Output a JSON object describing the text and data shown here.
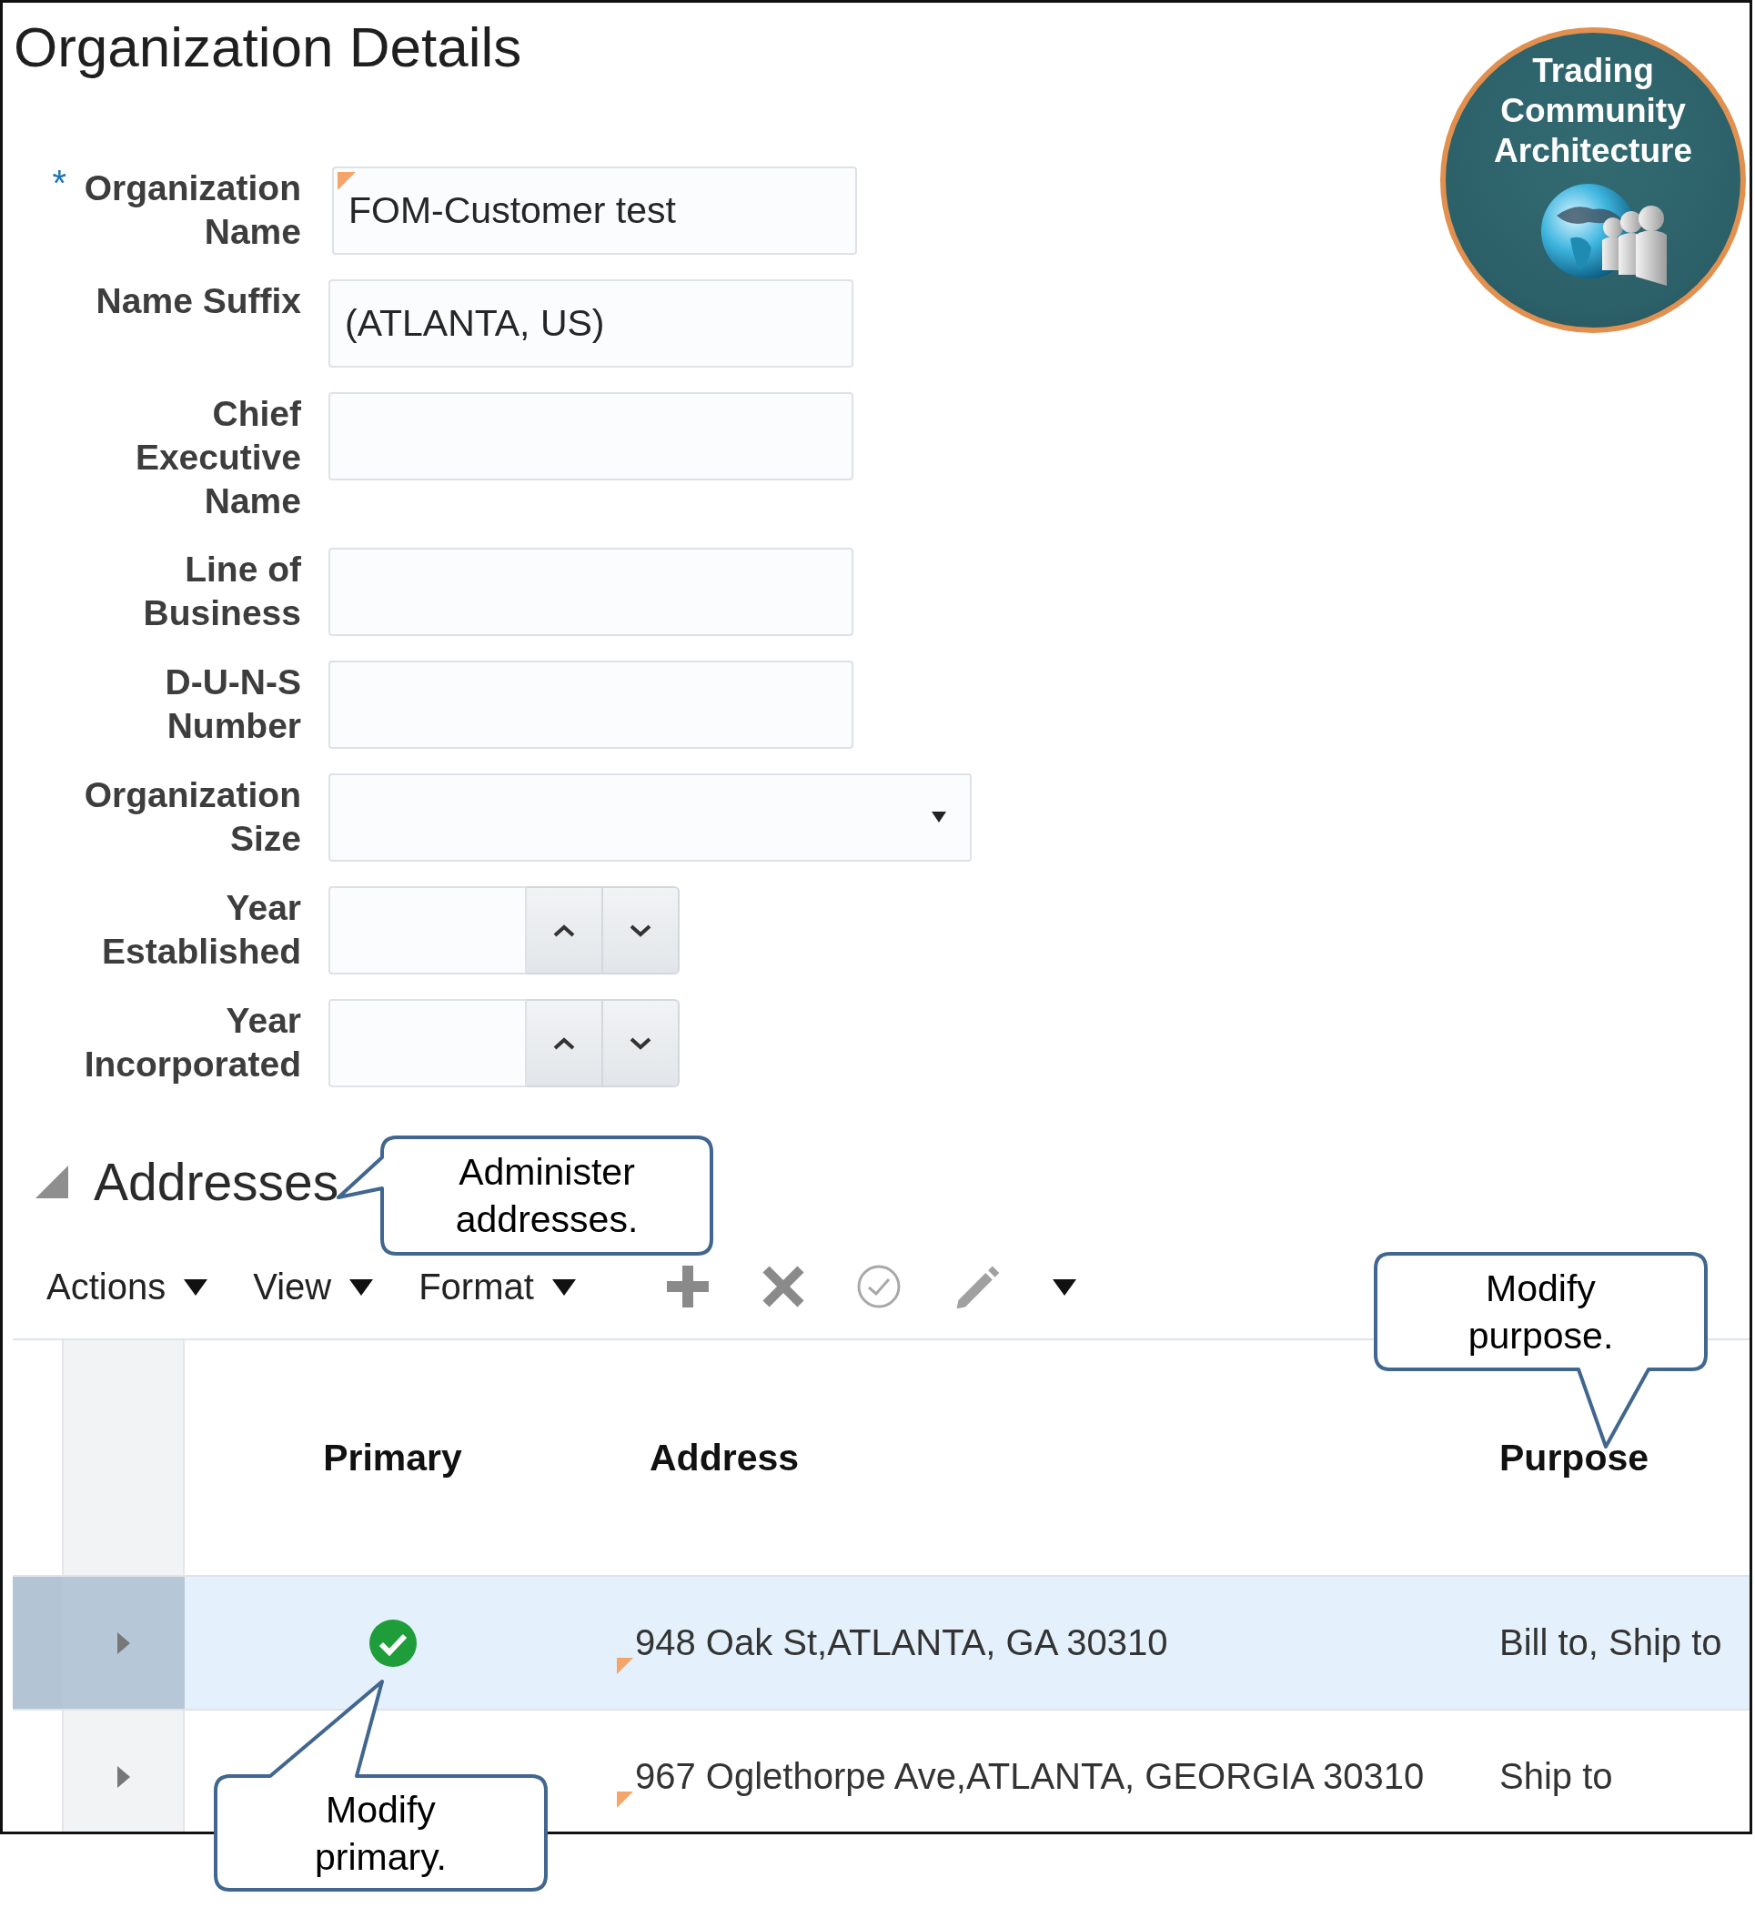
{
  "page_title": "Organization Details",
  "badge": {
    "title": "Trading Community Architecture"
  },
  "fields": [
    {
      "kind": "text",
      "label": "Organization Name",
      "required_mark": "*",
      "changed": true,
      "value": "FOM-Customer test"
    },
    {
      "kind": "text",
      "label": "Name Suffix",
      "changed": false,
      "value": "(ATLANTA, US)"
    },
    {
      "kind": "text",
      "label": "Chief Executive Name",
      "changed": false
    },
    {
      "kind": "text",
      "label": "Line of Business",
      "changed": false
    },
    {
      "kind": "text",
      "label": "D-U-N-S Number",
      "changed": false
    },
    {
      "kind": "select",
      "label": "Organization Size",
      "changed": false
    },
    {
      "kind": "spinner",
      "label": "Year Established",
      "changed": false
    },
    {
      "kind": "spinner",
      "label": "Year Incorporated",
      "changed": false
    }
  ],
  "addresses": {
    "title": "Addresses",
    "expanded": true,
    "menus": [
      {
        "label": "Actions"
      },
      {
        "label": "View"
      },
      {
        "label": "Format"
      }
    ],
    "tools": [
      {
        "kind": "add"
      },
      {
        "kind": "delete"
      },
      {
        "kind": "check"
      },
      {
        "kind": "edit"
      },
      {
        "kind": "more"
      }
    ],
    "columns": [
      "Primary",
      "Address",
      "Purpose"
    ],
    "rows": [
      {
        "selected": true,
        "primary": true,
        "changed": true,
        "address": "948 Oak St,ATLANTA, GA 30310",
        "purpose": "Bill to, Ship to"
      },
      {
        "selected": false,
        "primary": false,
        "changed": true,
        "address": "967 Oglethorpe Ave,ATLANTA, GEORGIA 30310",
        "purpose": "Ship to"
      }
    ]
  },
  "callouts": [
    {
      "text": "Administer addresses."
    },
    {
      "text": "Modify purpose."
    },
    {
      "text": "Modify primary."
    }
  ]
}
